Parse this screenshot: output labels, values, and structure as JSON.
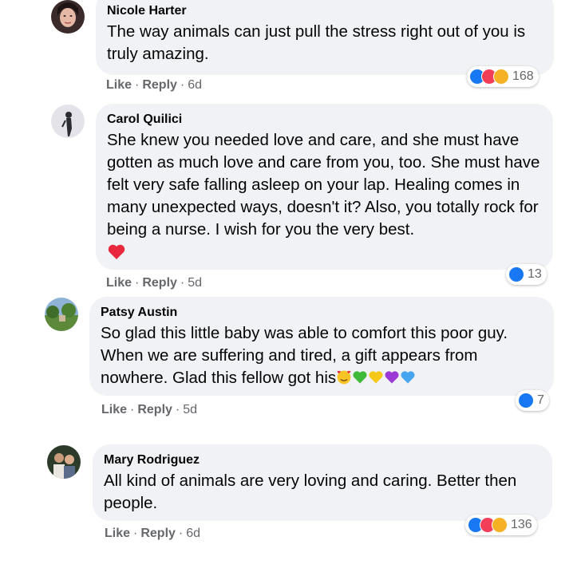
{
  "comments": [
    {
      "author": "Nicole Harter",
      "text": "The way animals can just pull the stress right out of you is truly amazing.",
      "like": "Like",
      "reply": "Reply",
      "time": "6d",
      "reactions": [
        "like",
        "love",
        "care"
      ],
      "reaction_count": "168"
    },
    {
      "author": "Carol Quilici",
      "text": "She knew you needed love and care, and she must have gotten as much love and care from you, too. She must have felt very safe falling asleep on your lap. Healing comes in many unexpected ways, doesn't it? Also, you totally rock for being a nurse. I wish for you the very best.",
      "like": "Like",
      "reply": "Reply",
      "time": "5d",
      "reactions": [
        "like"
      ],
      "reaction_count": "13"
    },
    {
      "author": "Patsy Austin",
      "text": "So glad this little baby was able to comfort this poor guy. When we are suffering and tired, a gift appears from nowhere. Glad this fellow got his",
      "like": "Like",
      "reply": "Reply",
      "time": "5d",
      "reactions": [
        "like"
      ],
      "reaction_count": "7"
    },
    {
      "author": "Mary Rodriguez",
      "text": "All kind of animals are very loving and caring. Better then people.",
      "like": "Like",
      "reply": "Reply",
      "time": "6d",
      "reactions": [
        "like",
        "love",
        "care"
      ],
      "reaction_count": "136"
    }
  ],
  "emojis": {
    "red_heart": "red-heart-emoji",
    "smiling_hearts": "smiling-face-with-hearts-emoji",
    "green_heart": "green-heart-emoji",
    "yellow_heart": "yellow-heart-emoji",
    "purple_heart": "purple-heart-emoji",
    "blue_heart": "blue-heart-emoji"
  },
  "colors": {
    "bubble": "#f0f2f5",
    "like_blue": "#1877f2",
    "love_red": "#f33e58",
    "care_yellow": "#f7b125",
    "meta_gray": "#65676b"
  }
}
